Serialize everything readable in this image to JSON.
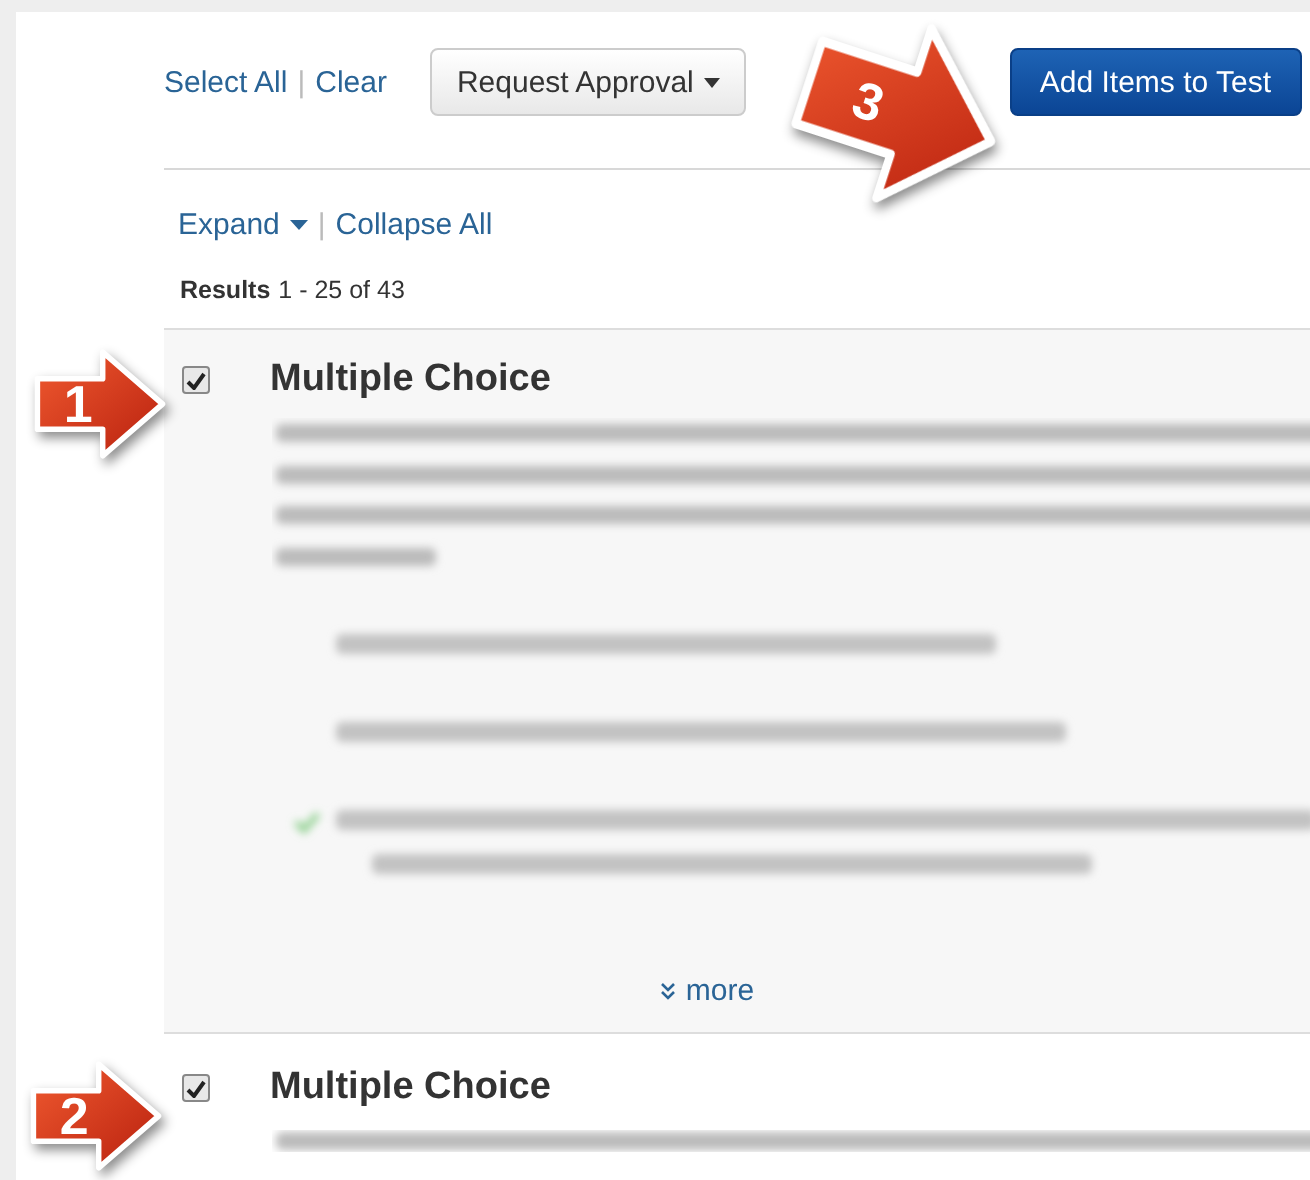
{
  "toolbar": {
    "select_all": "Select All",
    "separator": "|",
    "clear": "Clear",
    "request_approval": "Request Approval",
    "add_items": "Add Items to Test"
  },
  "view_controls": {
    "expand": "Expand",
    "separator": "|",
    "collapse_all": "Collapse All"
  },
  "results": {
    "label": "Results",
    "range": "1 - 25 of 43"
  },
  "items": [
    {
      "title": "Multiple Choice",
      "checked": true,
      "expanded": true,
      "more": "more"
    },
    {
      "title": "Multiple Choice",
      "checked": true,
      "expanded": false
    }
  ],
  "callouts": [
    {
      "number": "3"
    },
    {
      "number": "1"
    },
    {
      "number": "2"
    }
  ]
}
